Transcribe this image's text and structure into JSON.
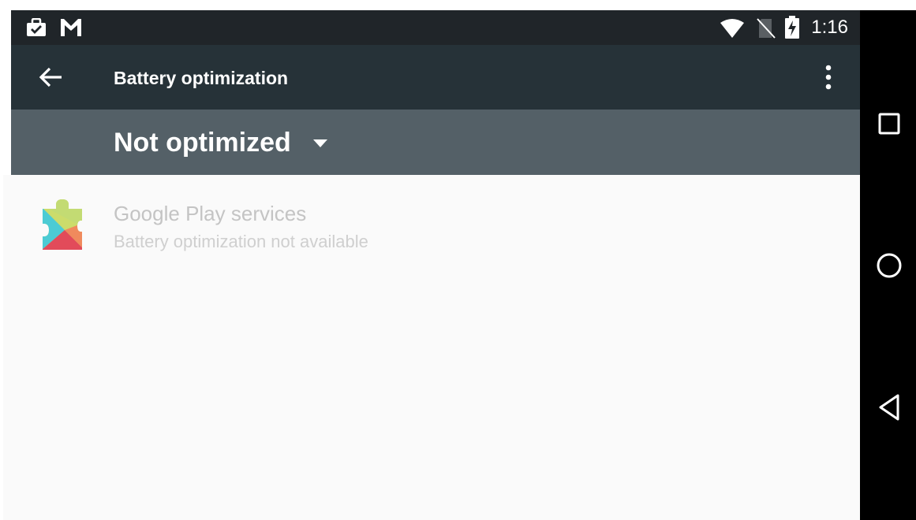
{
  "status_bar": {
    "time": "1:16",
    "icons": [
      "briefcase-check-icon",
      "gmail-icon",
      "wifi-icon",
      "no-sim-icon",
      "battery-charging-icon"
    ]
  },
  "app_bar": {
    "title": "Battery optimization",
    "back_icon": "arrow-back-icon",
    "menu_icon": "more-vert-icon"
  },
  "filter": {
    "selected": "Not optimized",
    "dropdown_icon": "dropdown-arrow-icon"
  },
  "apps": [
    {
      "name": "Google Play services",
      "status": "Battery optimization not available",
      "icon": "google-play-services-icon"
    }
  ],
  "navigation": {
    "icons": [
      "recents-icon",
      "home-icon",
      "back-icon"
    ]
  },
  "colors": {
    "status_bar": "#202529",
    "app_bar": "#263238",
    "filter_bar": "#546067",
    "content_bg": "#fafafa",
    "nav_bar": "#000000",
    "disabled_text": "#c4c4c4"
  }
}
